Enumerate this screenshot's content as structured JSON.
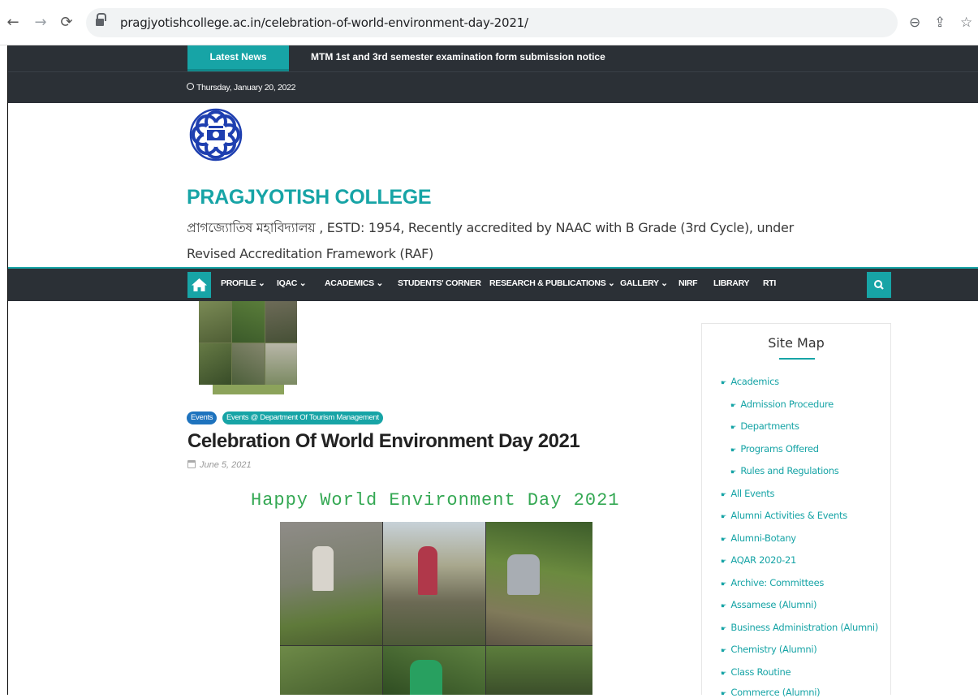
{
  "browser": {
    "url": "pragjyotishcollege.ac.in/celebration-of-world-environment-day-2021/"
  },
  "newsbar": {
    "label": "Latest News",
    "ticker": "MTM 1st and 3rd semester examination form submission notice"
  },
  "datebar": {
    "date": "Thursday, January 20, 2022"
  },
  "header": {
    "title": "PRAGJYOTISH COLLEGE",
    "tagline": "প্ৰাগজ্যোতিষ মহাবিদ্যালয় , ESTD: 1954, Recently accredited by NAAC with B Grade (3rd Cycle), under Revised Accreditation Framework (RAF)"
  },
  "nav": {
    "items": [
      {
        "label": "PROFILE",
        "dropdown": true
      },
      {
        "label": "IQAC",
        "dropdown": true
      },
      {
        "label": "ACADEMICS",
        "dropdown": true
      },
      {
        "label": "STUDENTS' CORNER",
        "dropdown": false
      },
      {
        "label": "RESEARCH & PUBLICATIONS",
        "dropdown": true
      },
      {
        "label": "GALLERY",
        "dropdown": true
      },
      {
        "label": "NIRF",
        "dropdown": false
      },
      {
        "label": "LIBRARY",
        "dropdown": false
      },
      {
        "label": "RTI",
        "dropdown": false
      }
    ],
    "caret": "⌄"
  },
  "post": {
    "categories": [
      "Events",
      "Events @ Department Of Tourism Management"
    ],
    "title": "Celebration Of World Environment Day 2021",
    "date": "June 5, 2021",
    "greeting": "Happy World Environment Day 2021"
  },
  "sidebar": {
    "title": "Site Map",
    "items": [
      {
        "label": "Academics",
        "level": 0
      },
      {
        "label": "Admission Procedure",
        "level": 1
      },
      {
        "label": "Departments",
        "level": 1
      },
      {
        "label": "Programs Offered",
        "level": 1
      },
      {
        "label": "Rules and Regulations",
        "level": 1
      },
      {
        "label": "All Events",
        "level": 0
      },
      {
        "label": "Alumni Activities & Events",
        "level": 0
      },
      {
        "label": "Alumni-Botany",
        "level": 0
      },
      {
        "label": "AQAR 2020-21",
        "level": 0
      },
      {
        "label": "Archive: Committees",
        "level": 0
      },
      {
        "label": "Assamese (Alumni)",
        "level": 0
      },
      {
        "label": "Business Administration (Alumni)",
        "level": 0
      },
      {
        "label": "Chemistry (Alumni)",
        "level": 0
      },
      {
        "label": "Class Routine",
        "level": 0
      },
      {
        "label": "Commerce (Alumni)",
        "level": 0
      }
    ]
  },
  "colors": {
    "accent": "#17a4a6",
    "dark": "#2b3036",
    "badge_events": "#1e73be",
    "greeting": "#34a853"
  }
}
